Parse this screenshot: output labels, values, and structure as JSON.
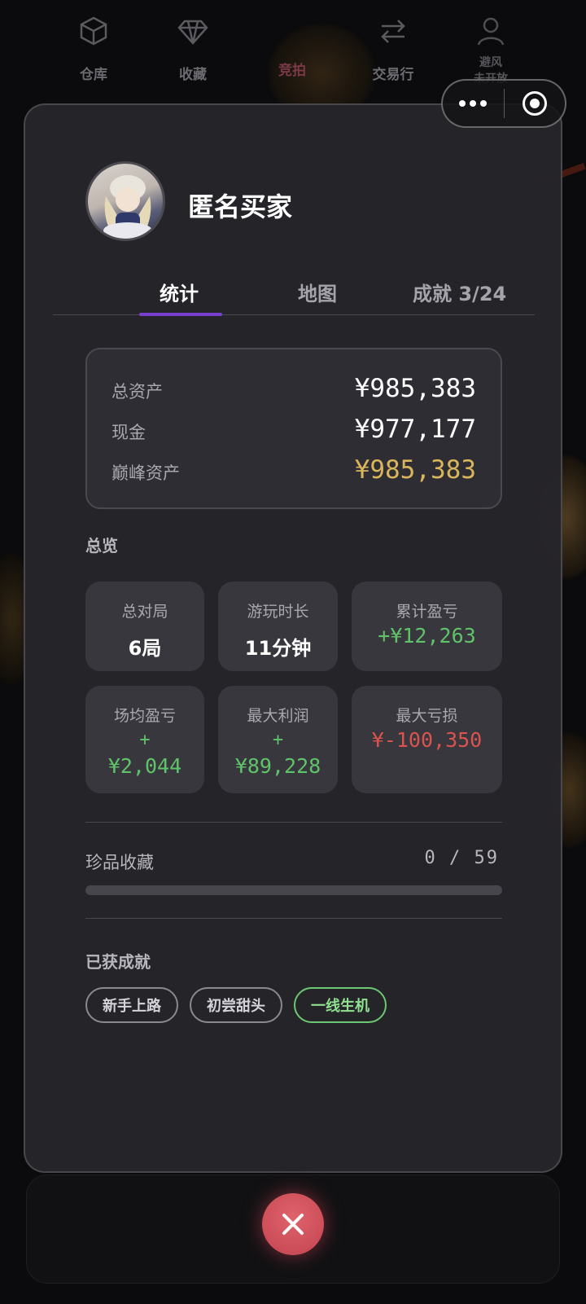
{
  "profile": {
    "name": "匿名买家"
  },
  "tabs": [
    {
      "label": "统计",
      "active": true
    },
    {
      "label": "地图",
      "active": false
    },
    {
      "label": "成就 3/24",
      "active": false
    }
  ],
  "assets": {
    "total_label": "总资产",
    "total_value": "¥985,383",
    "cash_label": "现金",
    "cash_value": "¥977,177",
    "peak_label": "巅峰资产",
    "peak_value": "¥985,383",
    "peak_color": "#d9b55b"
  },
  "overview": {
    "title": "总览",
    "games_label": "总对局",
    "games_value": "6局",
    "playtime_label": "游玩时长",
    "playtime_value": "11分钟",
    "total_pnl_label": "累计盈亏",
    "total_pnl_value": "+¥12,263",
    "avg_pnl_label": "场均盈亏",
    "avg_pnl_sign": "+",
    "avg_pnl_value": "¥2,044",
    "max_profit_label": "最大利润",
    "max_profit_sign": "+",
    "max_profit_value": "¥89,228",
    "max_loss_label": "最大亏损",
    "max_loss_value": "¥-100,350"
  },
  "treasure": {
    "label": "珍品收藏",
    "count": "0 / 59",
    "progress_fraction": 0
  },
  "achievements": {
    "title": "已获成就",
    "badges": [
      "新手上路",
      "初尝甜头",
      "一线生机"
    ]
  },
  "tabbar": {
    "warehouse": "仓库",
    "collect": "收藏",
    "auction": "竞拍",
    "trade": "交易行",
    "agent_line1": "避风",
    "agent_line2": "未开放"
  },
  "colors": {
    "accent": "#7b3fd0",
    "profit": "#5fc36a",
    "loss": "#d9534f",
    "close": "#d4515c"
  }
}
